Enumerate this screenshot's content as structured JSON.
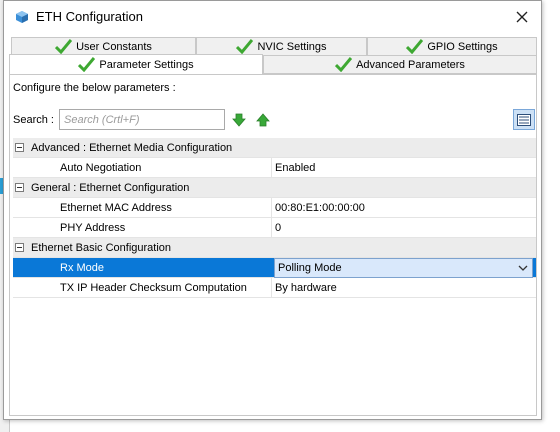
{
  "window": {
    "title": "ETH Configuration"
  },
  "tabs": {
    "row1": [
      {
        "label": "User Constants"
      },
      {
        "label": "NVIC Settings"
      },
      {
        "label": "GPIO Settings"
      }
    ],
    "row2": [
      {
        "label": "Parameter Settings",
        "active": true
      },
      {
        "label": "Advanced Parameters"
      }
    ]
  },
  "content": {
    "instructions": "Configure the below parameters :",
    "search": {
      "label": "Search :",
      "placeholder": "Search (Crtl+F)"
    },
    "groups": [
      {
        "title": "Advanced : Ethernet Media Configuration",
        "params": [
          {
            "name": "Auto Negotiation",
            "value": "Enabled"
          }
        ]
      },
      {
        "title": "General : Ethernet Configuration",
        "params": [
          {
            "name": "Ethernet MAC Address",
            "value": "00:80:E1:00:00:00"
          },
          {
            "name": "PHY Address",
            "value": "0"
          }
        ]
      },
      {
        "title": "Ethernet Basic Configuration",
        "params": [
          {
            "name": "Rx Mode",
            "value": "Polling Mode"
          },
          {
            "name": "TX IP Header Checksum Computation",
            "value": "By hardware"
          }
        ]
      }
    ]
  },
  "colors": {
    "selection": "#0a78d7",
    "check_green": "#3ea832",
    "arrow_green": "#38a838"
  },
  "icons": {
    "app": "cube-icon",
    "close": "close-icon",
    "tab_status": "checkmark-icon",
    "down": "green-down-arrow-icon",
    "up": "green-up-arrow-icon",
    "view": "list-view-icon"
  }
}
